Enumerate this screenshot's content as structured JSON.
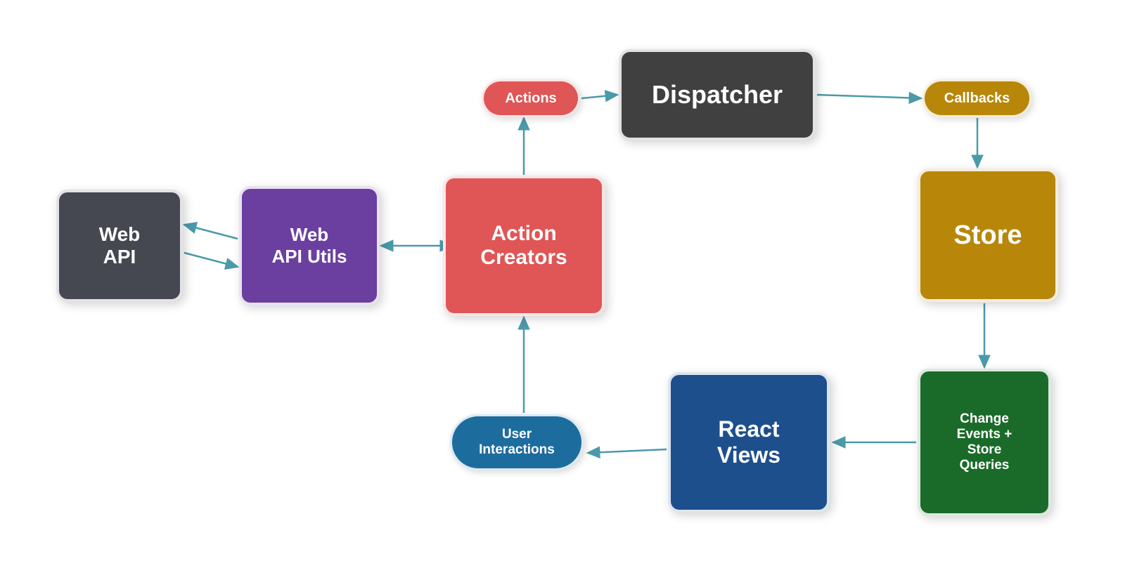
{
  "nodes": {
    "dispatcher": {
      "label": "Dispatcher"
    },
    "action_creators": {
      "label": "Action\nCreators"
    },
    "web_api_utils": {
      "label": "Web\nAPI Utils"
    },
    "web_api": {
      "label": "Web\nAPI"
    },
    "store": {
      "label": "Store"
    },
    "react_views": {
      "label": "React\nViews"
    },
    "change_events": {
      "label": "Change\nEvents +\nStore\nQueries"
    }
  },
  "pills": {
    "actions": {
      "label": "Actions"
    },
    "callbacks": {
      "label": "Callbacks"
    },
    "user_interactions": {
      "label": "User\nInteractions"
    }
  },
  "colors": {
    "dispatcher": "#404040",
    "action_creators": "#e05555",
    "web_api_utils": "#6b3fa0",
    "web_api": "#454850",
    "store": "#b8870a",
    "react_views": "#1d4f8c",
    "change_events": "#1a6b2a",
    "actions_pill": "#e05555",
    "callbacks_pill": "#b8870a",
    "user_pill": "#1d6c9e",
    "arrow": "#4a9aaa"
  }
}
